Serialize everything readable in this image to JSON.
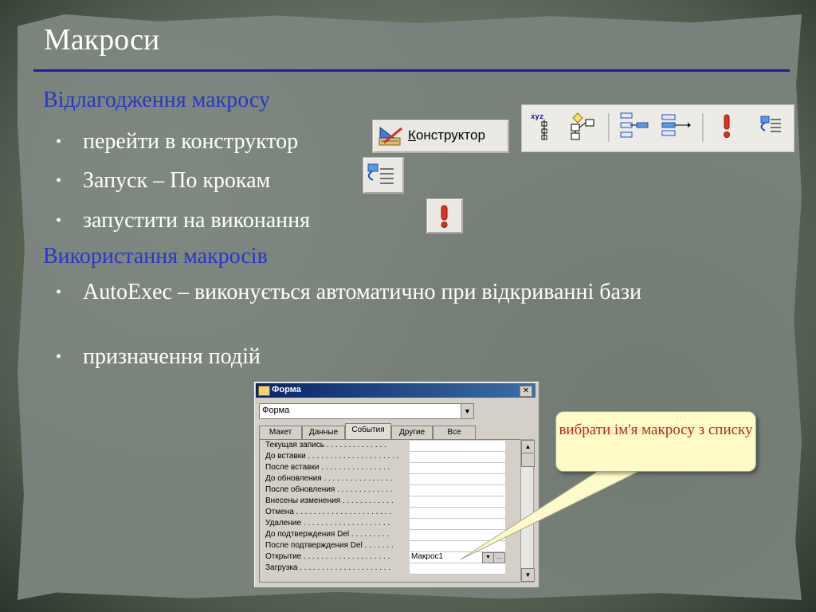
{
  "slide": {
    "title": "Макроси",
    "section1": "Відлагодження макросу",
    "bullets1": [
      "перейти в конструктор",
      "Запуск – По крокам",
      "запустити  на виконання"
    ],
    "section2": "Використання макросів",
    "bullets2": [
      "AutoExec – виконується автоматично при відкриванні бази",
      "призначення подій"
    ],
    "bullet_char": "•"
  },
  "toolbar": {
    "constructor_label_underlined": "К",
    "constructor_label_rest": "онструктор",
    "icons": [
      "macro-names-icon",
      "conditions-icon",
      "insert-row-icon",
      "delete-row-icon",
      "run-icon",
      "single-step-icon"
    ]
  },
  "dialog": {
    "title": "Форма",
    "close": "✕",
    "object_selector": "Форма",
    "tabs": [
      "Макет",
      "Данные",
      "События",
      "Другие",
      "Все"
    ],
    "active_tab": "События",
    "properties": [
      {
        "label": "Текущая запись . . . . . . . . . . . . . .",
        "value": ""
      },
      {
        "label": "До вставки . . . . . . . . . . . . . . . . . . . . .",
        "value": ""
      },
      {
        "label": "После вставки . . . . . . . . . . . . . . . .",
        "value": ""
      },
      {
        "label": "До обновления . . . . . . . . . . . . . . . .",
        "value": ""
      },
      {
        "label": "После обновления . . . . . . . . . . . . .",
        "value": ""
      },
      {
        "label": "Внесены изменения . . . . . . . . . . . .",
        "value": ""
      },
      {
        "label": "Отмена . . . . . . . . . . . . . . . . . . . . . .",
        "value": ""
      },
      {
        "label": "Удаление . . . . . . . . . . . . . . . . . . . .",
        "value": ""
      },
      {
        "label": "До подтверждения Del . . . . . . . . .",
        "value": ""
      },
      {
        "label": "После подтверждения Del . . . . . . .",
        "value": ""
      },
      {
        "label": "Открытие . . . . . . . . . . . . . . . . . . . .",
        "value": "Макрос1"
      },
      {
        "label": "Загрузка . . . . . . . . . . . . . . . . . . . . .",
        "value": ""
      }
    ]
  },
  "callout": {
    "text": "вибрати ім'я макросу з списку"
  },
  "colors": {
    "title_rule": "#1b1fa0",
    "section_text": "#2a36c6",
    "callout_text": "#c0241e",
    "callout_bg": "#fffbc9"
  }
}
